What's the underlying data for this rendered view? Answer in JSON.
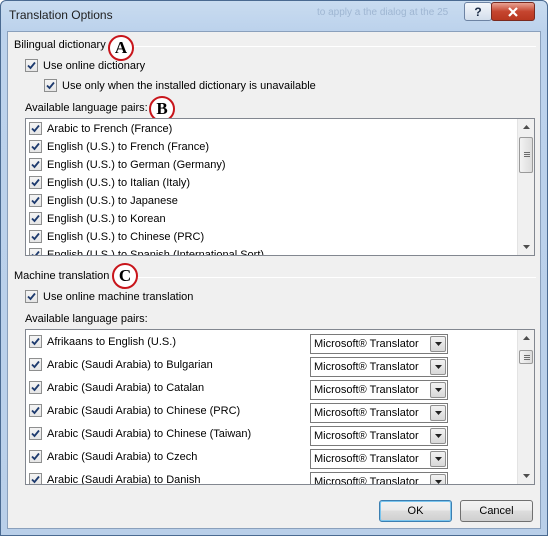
{
  "window": {
    "title": "Translation Options",
    "background_title": "to apply a the dialog at the 25"
  },
  "bilingual": {
    "group_label": "Bilingual dictionary",
    "callout": "A",
    "use_online": {
      "label": "Use online dictionary",
      "checked": true
    },
    "only_when_unavailable": {
      "label": "Use only when the installed dictionary is unavailable",
      "checked": true
    },
    "pairs_label": "Available language pairs:",
    "pairs_callout": "B",
    "pairs": [
      {
        "label": "Arabic to French (France)",
        "checked": true
      },
      {
        "label": "English (U.S.) to French (France)",
        "checked": true
      },
      {
        "label": "English (U.S.) to German (Germany)",
        "checked": true
      },
      {
        "label": "English (U.S.) to Italian (Italy)",
        "checked": true
      },
      {
        "label": "English (U.S.) to Japanese",
        "checked": true
      },
      {
        "label": "English (U.S.) to Korean",
        "checked": true
      },
      {
        "label": "English (U.S.) to Chinese (PRC)",
        "checked": true
      },
      {
        "label": "English (U.S.) to Spanish (International Sort)",
        "checked": true
      }
    ]
  },
  "machine": {
    "group_label": "Machine translation",
    "callout": "C",
    "use_online": {
      "label": "Use online machine translation",
      "checked": true
    },
    "pairs_label": "Available language pairs:",
    "pairs": [
      {
        "label": "Afrikaans to English (U.S.)",
        "provider": "Microsoft® Translator",
        "checked": true
      },
      {
        "label": "Arabic (Saudi Arabia) to Bulgarian",
        "provider": "Microsoft® Translator",
        "checked": true
      },
      {
        "label": "Arabic (Saudi Arabia) to Catalan",
        "provider": "Microsoft® Translator",
        "checked": true
      },
      {
        "label": "Arabic (Saudi Arabia) to Chinese (PRC)",
        "provider": "Microsoft® Translator",
        "checked": true
      },
      {
        "label": "Arabic (Saudi Arabia) to Chinese (Taiwan)",
        "provider": "Microsoft® Translator",
        "checked": true
      },
      {
        "label": "Arabic (Saudi Arabia) to Czech",
        "provider": "Microsoft® Translator",
        "checked": true
      },
      {
        "label": "Arabic (Saudi Arabia) to Danish",
        "provider": "Microsoft® Translator",
        "checked": true
      }
    ]
  },
  "buttons": {
    "ok": "OK",
    "cancel": "Cancel"
  },
  "colors": {
    "callout_border": "#c8151b",
    "title_bar": "#bcd2ec",
    "default_button": "#3c7fb1"
  }
}
